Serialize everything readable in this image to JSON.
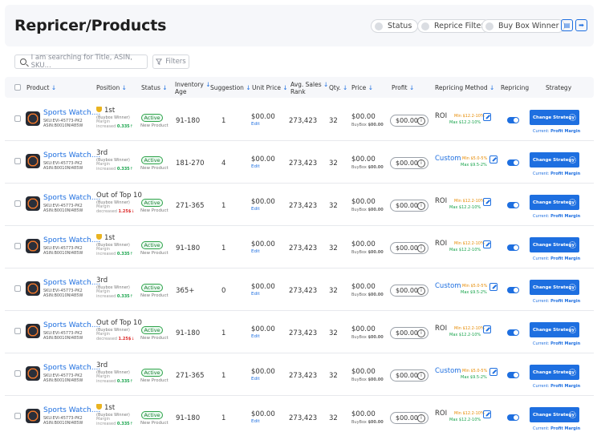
{
  "page": {
    "title": "Repricer/Products"
  },
  "header": {
    "chips": [
      "Status",
      "Reprice Filter",
      "Buy Box Winner"
    ],
    "icons": [
      "document-icon",
      "export-icon"
    ]
  },
  "toolbar": {
    "search_placeholder": "I am searching for Title, ASIN, SKU...",
    "filters_label": "Filters"
  },
  "columns": {
    "product": "Product",
    "position": "Position",
    "status": "Status",
    "inventory_age_1": "Inventory",
    "inventory_age_2": "Age",
    "suggestion": "Suggestion",
    "unit_price": "Unit Price",
    "avg_sales_rank_1": "Avg. Sales",
    "avg_sales_rank_2": "Rank",
    "qty": "Qty.",
    "price": "Price",
    "profit": "Profit",
    "repricing_method": "Repricing Method",
    "repricing": "Repricing",
    "strategy": "Strategy",
    "sort_arrow": "↓"
  },
  "labels": {
    "sku_prefix": "SKU:",
    "asin_prefix": "ASIN:",
    "buybox_winner": "(Buybox Winner)",
    "margin": "Margin",
    "edit": "Edit",
    "buybox_prefix": "BuyBox",
    "change_strategy": "Change Strategy",
    "current_prefix": "Current:",
    "info_glyph": "i"
  },
  "rows": [
    {
      "name": "Sports Watch....",
      "sku": "EVI-45773-PK2",
      "asin": "B0010NI485W",
      "position": "1st",
      "trophy": true,
      "margin_dir": "increased",
      "margin_val": "0.335",
      "margin_arrow": "↑",
      "status": "Active",
      "status_sub": "New Product",
      "inventory_age": "91-180",
      "suggestion": "1",
      "unit_price": "$00.00",
      "avg_sales_rank": "273,423",
      "qty": "32",
      "price": "$00.00",
      "buybox": "$00.00",
      "profit": "$00.00",
      "method": "ROI",
      "method_type": "roi",
      "min": "Min $12.2-10%",
      "max": "Max $12.2-10%",
      "current": "Profit Margin"
    },
    {
      "name": "Sports Watch....",
      "sku": "EVI-45773-PK2",
      "asin": "B0010NI485W",
      "position": "3rd",
      "trophy": false,
      "margin_dir": "increased",
      "margin_val": "0.335",
      "margin_arrow": "↑",
      "status": "Active",
      "status_sub": "New Product",
      "inventory_age": "181-270",
      "suggestion": "4",
      "unit_price": "$00.00",
      "avg_sales_rank": "273,423",
      "qty": "32",
      "price": "$00.00",
      "buybox": "$00.00",
      "profit": "$00.00",
      "method": "Custom",
      "method_type": "custom",
      "min": "Min $5.0-5%",
      "max": "Max $9.5-2%",
      "current": "Profit Margin"
    },
    {
      "name": "Sports Watch....",
      "sku": "EVI-45773-PK2",
      "asin": "B0010NI485W",
      "position": "Out of Top 10",
      "trophy": false,
      "margin_dir": "decreased",
      "margin_val": "1.25$",
      "margin_arrow": "↓",
      "status": "Active",
      "status_sub": "New Product",
      "inventory_age": "271-365",
      "suggestion": "1",
      "unit_price": "$00.00",
      "avg_sales_rank": "273,423",
      "qty": "32",
      "price": "$00.00",
      "buybox": "$00.00",
      "profit": "$00.00",
      "method": "ROI",
      "method_type": "roi",
      "min": "Min $12.2-10%",
      "max": "Max $12.2-10%",
      "current": "Profit Margin"
    },
    {
      "name": "Sports Watch....",
      "sku": "EVI-45773-PK2",
      "asin": "B0010NI485W",
      "position": "1st",
      "trophy": true,
      "margin_dir": "increased",
      "margin_val": "0.335",
      "margin_arrow": "↑",
      "status": "Active",
      "status_sub": "New Product",
      "inventory_age": "91-180",
      "suggestion": "1",
      "unit_price": "$00.00",
      "avg_sales_rank": "273,423",
      "qty": "32",
      "price": "$00.00",
      "buybox": "$00.00",
      "profit": "$00.00",
      "method": "ROI",
      "method_type": "roi",
      "min": "Min $12.2-10%",
      "max": "Max $12.2-10%",
      "current": "Profit Margin"
    },
    {
      "name": "Sports Watch....",
      "sku": "EVI-45773-PK2",
      "asin": "B0010NI485W",
      "position": "3rd",
      "trophy": false,
      "margin_dir": "increased",
      "margin_val": "0.335",
      "margin_arrow": "↑",
      "status": "Active",
      "status_sub": "New Product",
      "inventory_age": "365+",
      "suggestion": "0",
      "unit_price": "$00.00",
      "avg_sales_rank": "273,423",
      "qty": "32",
      "price": "$00.00",
      "buybox": "$00.00",
      "profit": "$00.00",
      "method": "Custom",
      "method_type": "custom",
      "min": "Min $5.0-5%",
      "max": "Max $9.5-2%",
      "current": "Profit Margin"
    },
    {
      "name": "Sports Watch....",
      "sku": "EVI-45773-PK2",
      "asin": "B0010NI485W",
      "position": "Out of Top 10",
      "trophy": false,
      "margin_dir": "decreased",
      "margin_val": "1.25$",
      "margin_arrow": "↓",
      "status": "Active",
      "status_sub": "New Product",
      "inventory_age": "91-180",
      "suggestion": "1",
      "unit_price": "$00.00",
      "avg_sales_rank": "273,423",
      "qty": "32",
      "price": "$00.00",
      "buybox": "$00.00",
      "profit": "$00.00",
      "method": "ROI",
      "method_type": "roi",
      "min": "Min $12.2-10%",
      "max": "Max $12.2-10%",
      "current": "Profit Margin"
    },
    {
      "name": "Sports Watch....",
      "sku": "EVI-45773-PK2",
      "asin": "B0010NI485W",
      "position": "3rd",
      "trophy": false,
      "margin_dir": "increased",
      "margin_val": "0.335",
      "margin_arrow": "↑",
      "status": "Active",
      "status_sub": "New Product",
      "inventory_age": "271-365",
      "suggestion": "1",
      "unit_price": "$00.00",
      "avg_sales_rank": "273,423",
      "qty": "32",
      "price": "$00.00",
      "buybox": "$00.00",
      "profit": "$00.00",
      "method": "Custom",
      "method_type": "custom",
      "min": "Min $5.0-5%",
      "max": "Max $9.5-2%",
      "current": "Profit Margin"
    },
    {
      "name": "Sports Watch....",
      "sku": "EVI-45773-PK2",
      "asin": "B0010NI485W",
      "position": "1st",
      "trophy": true,
      "margin_dir": "increased",
      "margin_val": "0.335",
      "margin_arrow": "↑",
      "status": "Active",
      "status_sub": "New Product",
      "inventory_age": "91-180",
      "suggestion": "1",
      "unit_price": "$00.00",
      "avg_sales_rank": "273,423",
      "qty": "32",
      "price": "$00.00",
      "buybox": "$00.00",
      "profit": "$00.00",
      "method": "ROI",
      "method_type": "roi",
      "min": "Min $12.2-10%",
      "max": "Max $12.2-10%",
      "current": "Profit Margin"
    }
  ]
}
